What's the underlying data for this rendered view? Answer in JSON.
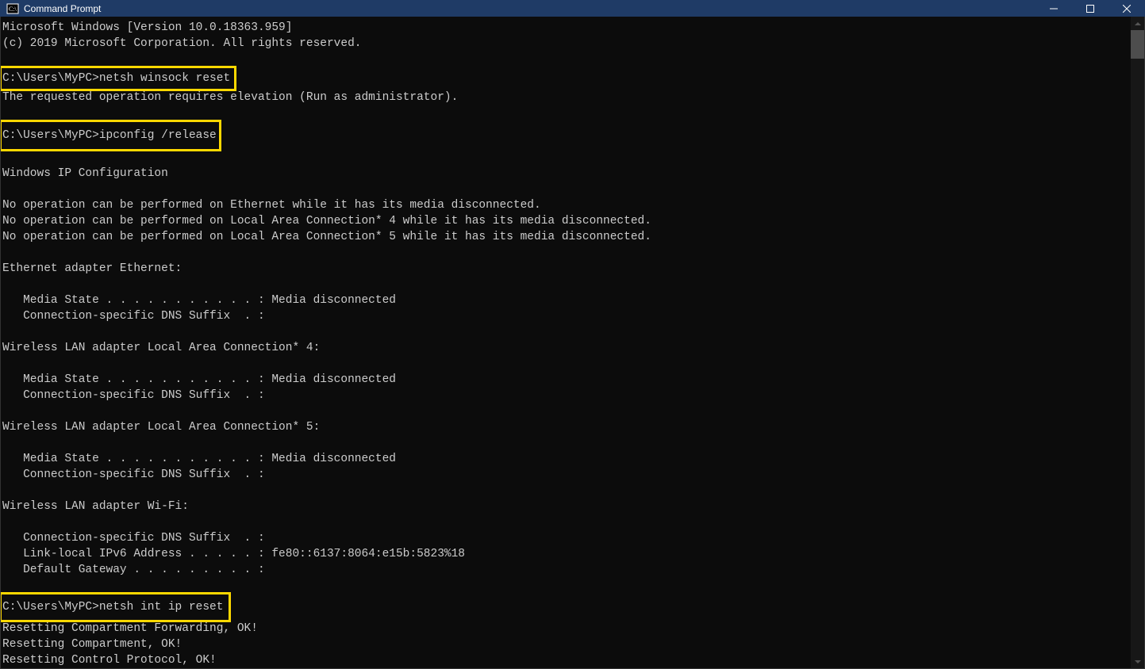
{
  "titlebar": {
    "icon_label": "cmd-icon",
    "title": "Command Prompt"
  },
  "terminal": {
    "lines": [
      "Microsoft Windows [Version 10.0.18363.959]",
      "(c) 2019 Microsoft Corporation. All rights reserved.",
      "",
      "",
      "The requested operation requires elevation (Run as administrator).",
      "",
      "",
      "",
      "Windows IP Configuration",
      "",
      "No operation can be performed on Ethernet while it has its media disconnected.",
      "No operation can be performed on Local Area Connection* 4 while it has its media disconnected.",
      "No operation can be performed on Local Area Connection* 5 while it has its media disconnected.",
      "",
      "Ethernet adapter Ethernet:",
      "",
      "   Media State . . . . . . . . . . . : Media disconnected",
      "   Connection-specific DNS Suffix  . :",
      "",
      "Wireless LAN adapter Local Area Connection* 4:",
      "",
      "   Media State . . . . . . . . . . . : Media disconnected",
      "   Connection-specific DNS Suffix  . :",
      "",
      "Wireless LAN adapter Local Area Connection* 5:",
      "",
      "   Media State . . . . . . . . . . . : Media disconnected",
      "   Connection-specific DNS Suffix  . :",
      "",
      "Wireless LAN adapter Wi-Fi:",
      "",
      "   Connection-specific DNS Suffix  . :",
      "   Link-local IPv6 Address . . . . . : fe80::6137:8064:e15b:5823%18",
      "   Default Gateway . . . . . . . . . :",
      "",
      "",
      "Resetting Compartment Forwarding, OK!",
      "Resetting Compartment, OK!",
      "Resetting Control Protocol, OK!"
    ],
    "highlights": {
      "cmd1_prompt": "C:\\Users\\MyPC>",
      "cmd1_cmd": "netsh winsock reset",
      "cmd2_prompt": "C:\\Users\\MyPC>",
      "cmd2_cmd": "ipconfig /release",
      "cmd3_prompt": "C:\\Users\\MyPC>",
      "cmd3_cmd": "netsh int ip reset"
    }
  }
}
